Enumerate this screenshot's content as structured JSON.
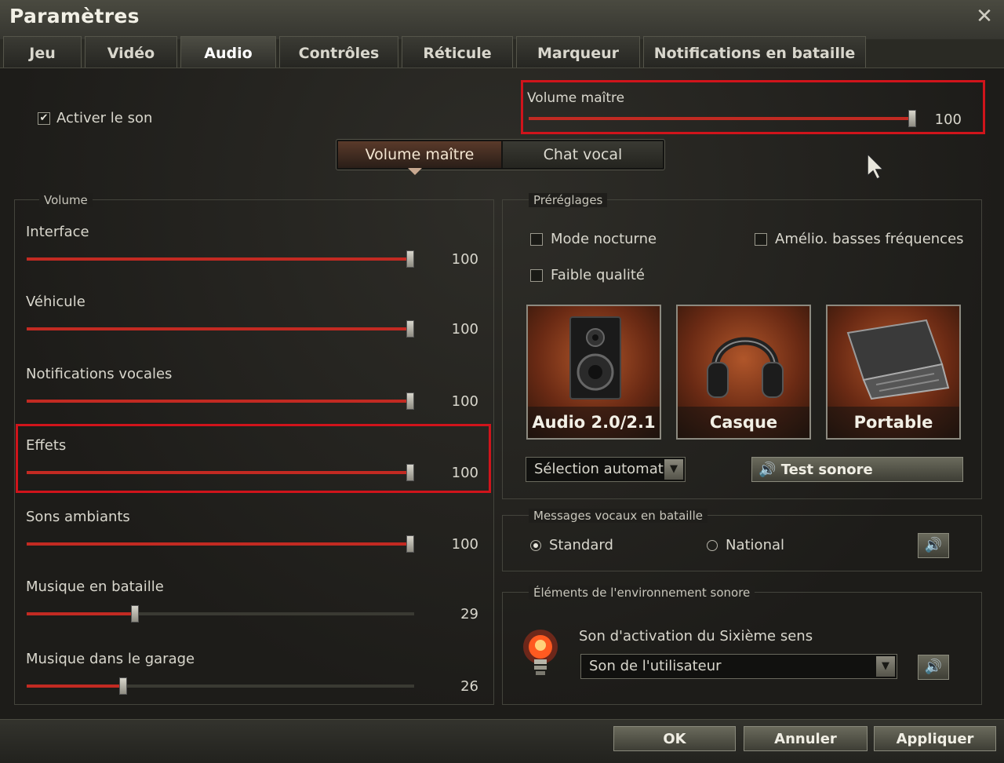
{
  "window": {
    "title": "Paramètres",
    "close_icon": "close-icon"
  },
  "tabs": [
    {
      "label": "Jeu"
    },
    {
      "label": "Vidéo"
    },
    {
      "label": "Audio",
      "active": true
    },
    {
      "label": "Contrôles"
    },
    {
      "label": "Réticule"
    },
    {
      "label": "Marqueur"
    },
    {
      "label": "Notifications en bataille"
    }
  ],
  "enable_sound": {
    "label": "Activer le son",
    "checked": true
  },
  "master_volume": {
    "label": "Volume maître",
    "value": "100",
    "level": 100
  },
  "mode_toggle": {
    "master": "Volume maître",
    "voice": "Chat vocal",
    "selected": "master"
  },
  "volume": {
    "legend": "Volume",
    "sliders": [
      {
        "label": "Interface",
        "value": "100",
        "level": 100
      },
      {
        "label": "Véhicule",
        "value": "100",
        "level": 100
      },
      {
        "label": "Notifications vocales",
        "value": "100",
        "level": 100
      },
      {
        "label": "Effets",
        "value": "100",
        "level": 100
      },
      {
        "label": "Sons ambiants",
        "value": "100",
        "level": 100
      },
      {
        "label": "Musique en bataille",
        "value": "29",
        "level": 29
      },
      {
        "label": "Musique dans le garage",
        "value": "26",
        "level": 26
      }
    ]
  },
  "presets": {
    "legend": "Préréglages",
    "night_mode": {
      "label": "Mode nocturne",
      "checked": false
    },
    "bass_boost": {
      "label": "Amélio. basses fréquences",
      "checked": false
    },
    "low_quality": {
      "label": "Faible qualité",
      "checked": false
    },
    "devices": [
      {
        "label": "Audio 2.0/2.1",
        "icon": "speaker-icon"
      },
      {
        "label": "Casque",
        "icon": "headphones-icon"
      },
      {
        "label": "Portable",
        "icon": "laptop-icon"
      }
    ],
    "auto_select": "Sélection automati",
    "test_button": "Test sonore"
  },
  "battle_voice": {
    "legend": "Messages vocaux en bataille",
    "standard": "Standard",
    "national": "National",
    "selected": "standard"
  },
  "environment": {
    "legend": "Éléments de l'environnement sonore",
    "sixth_sense_label": "Son d'activation du Sixième sens",
    "sixth_sense_value": "Son de l'utilisateur",
    "icon": "lightbulb-icon"
  },
  "footer": {
    "ok": "OK",
    "cancel": "Annuler",
    "apply": "Appliquer"
  },
  "colors": {
    "accent_red": "#d0141b",
    "slider_fill": "#c22a22"
  }
}
